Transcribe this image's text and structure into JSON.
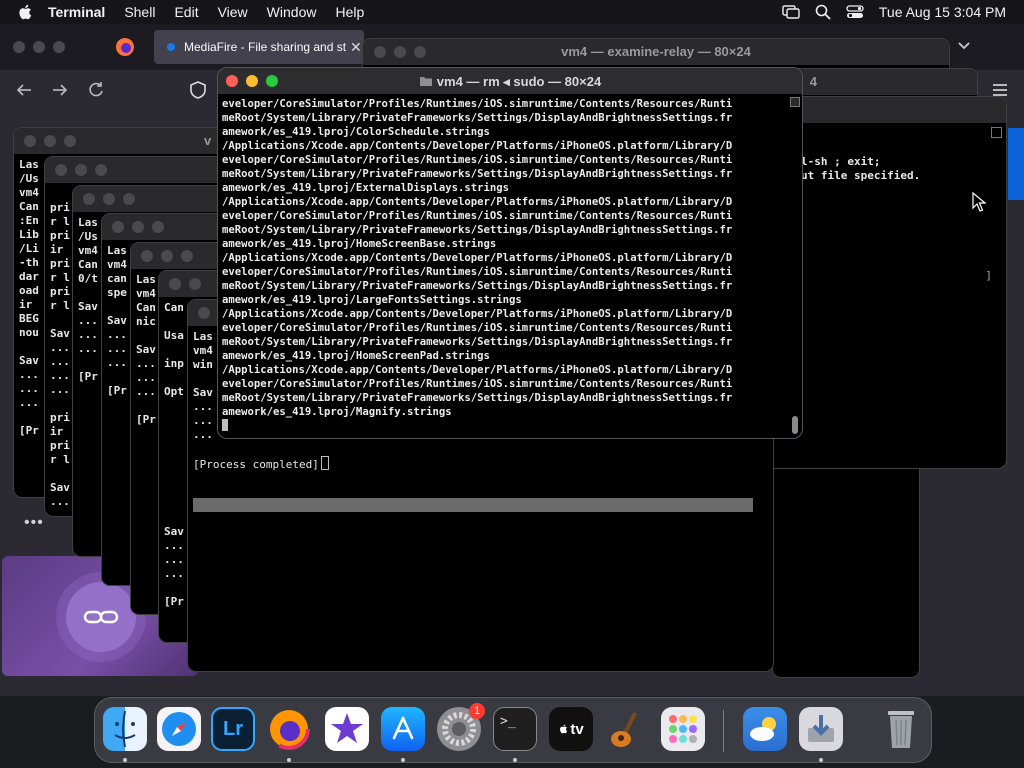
{
  "menubar": {
    "app_name": "Terminal",
    "items": [
      "Shell",
      "Edit",
      "View",
      "Window",
      "Help"
    ],
    "clock": "Tue Aug 15  3:04 PM",
    "icons": [
      "screen-mirroring-icon",
      "search-icon",
      "control-center-icon"
    ]
  },
  "browser": {
    "active_tab_title": "MediaFire - File sharing and stor",
    "tab_close": "✕",
    "page_dots": "•••"
  },
  "windows": {
    "examine_relay_title": "vm4 — examine-relay — 80×24",
    "examine_relay_lines": [
      "l-sh ; exit;",
      "ut file specified."
    ],
    "bg_title_small": "v",
    "bg_title_right": "4",
    "w1_lines": [
      "Las",
      "/Us",
      "vm4",
      "Can",
      ":En",
      "Lib",
      "/Li",
      "-th",
      "dar",
      "oad",
      "ir ",
      "BEG",
      "nou",
      "",
      "Sav",
      "...",
      "...",
      "...",
      "",
      "[Pr"
    ],
    "w2_lines": [
      "",
      "pri",
      "r l",
      "pri",
      "ir ",
      "pri",
      "r l",
      "pri",
      "r l",
      "",
      "Sav",
      "...",
      "...",
      "...",
      "...",
      "",
      "pri",
      "ir ",
      "pri",
      "r l",
      "",
      "Sav",
      "...",
      "...",
      "...",
      "",
      "[Pr"
    ],
    "w3_lines": [
      "Las",
      "/Us",
      "vm4",
      "Can",
      "0/t",
      "",
      "Sav",
      "...",
      "...",
      "...",
      "",
      "[Pr"
    ],
    "w4_lines": [
      "Las",
      "vm4",
      "can",
      "spe",
      "",
      "Sav",
      "...",
      "...",
      "...",
      "",
      "[Pr"
    ],
    "w5_lines": [
      "Las",
      "vm4",
      "Can",
      "nic",
      "",
      "Sav",
      "...",
      "...",
      "...",
      "",
      "[Pr"
    ],
    "w6_lines": [
      "Can",
      "",
      "Usa",
      "",
      "inp",
      "",
      "Opt",
      "",
      "",
      "",
      "",
      "",
      "",
      "",
      "",
      "",
      "Sav",
      "...",
      "...",
      "...",
      "",
      "[Pr"
    ],
    "w7_lines": [
      "Las",
      "vm4",
      "win",
      "",
      "Sav",
      "...",
      "...",
      "..."
    ],
    "process_completed": "[Process completed]"
  },
  "main_terminal": {
    "title": "vm4 — rm ◂ sudo — 80×24",
    "lines": [
      "eveloper/CoreSimulator/Profiles/Runtimes/iOS.simruntime/Contents/Resources/Runti",
      "meRoot/System/Library/PrivateFrameworks/Settings/DisplayAndBrightnessSettings.fr",
      "amework/es_419.lproj/ColorSchedule.strings",
      "/Applications/Xcode.app/Contents/Developer/Platforms/iPhoneOS.platform/Library/D",
      "eveloper/CoreSimulator/Profiles/Runtimes/iOS.simruntime/Contents/Resources/Runti",
      "meRoot/System/Library/PrivateFrameworks/Settings/DisplayAndBrightnessSettings.fr",
      "amework/es_419.lproj/ExternalDisplays.strings",
      "/Applications/Xcode.app/Contents/Developer/Platforms/iPhoneOS.platform/Library/D",
      "eveloper/CoreSimulator/Profiles/Runtimes/iOS.simruntime/Contents/Resources/Runti",
      "meRoot/System/Library/PrivateFrameworks/Settings/DisplayAndBrightnessSettings.fr",
      "amework/es_419.lproj/HomeScreenBase.strings",
      "/Applications/Xcode.app/Contents/Developer/Platforms/iPhoneOS.platform/Library/D",
      "eveloper/CoreSimulator/Profiles/Runtimes/iOS.simruntime/Contents/Resources/Runti",
      "meRoot/System/Library/PrivateFrameworks/Settings/DisplayAndBrightnessSettings.fr",
      "amework/es_419.lproj/LargeFontsSettings.strings",
      "/Applications/Xcode.app/Contents/Developer/Platforms/iPhoneOS.platform/Library/D",
      "eveloper/CoreSimulator/Profiles/Runtimes/iOS.simruntime/Contents/Resources/Runti",
      "meRoot/System/Library/PrivateFrameworks/Settings/DisplayAndBrightnessSettings.fr",
      "amework/es_419.lproj/HomeScreenPad.strings",
      "/Applications/Xcode.app/Contents/Developer/Platforms/iPhoneOS.platform/Library/D",
      "eveloper/CoreSimulator/Profiles/Runtimes/iOS.simruntime/Contents/Resources/Runti",
      "meRoot/System/Library/PrivateFrameworks/Settings/DisplayAndBrightnessSettings.fr",
      "amework/es_419.lproj/Magnify.strings"
    ]
  },
  "dock": {
    "apps": [
      {
        "name": "finder",
        "icon": "finder-icon",
        "running": true
      },
      {
        "name": "safari",
        "icon": "safari-icon",
        "running": false
      },
      {
        "name": "lightroom",
        "icon": "lightroom-icon",
        "label": "Lr",
        "running": false
      },
      {
        "name": "firefox",
        "icon": "firefox-icon",
        "running": true
      },
      {
        "name": "imovie",
        "icon": "imovie-icon",
        "running": false
      },
      {
        "name": "app-store",
        "icon": "app-store-icon",
        "running": true
      },
      {
        "name": "system-settings",
        "icon": "gear-icon",
        "badge": "1",
        "running": false
      },
      {
        "name": "terminal",
        "icon": "terminal-icon",
        "label": ">_",
        "running": true
      },
      {
        "name": "apple-tv",
        "icon": "apple-tv-icon",
        "label": "tv",
        "running": false
      },
      {
        "name": "garageband",
        "icon": "guitar-icon",
        "running": false
      },
      {
        "name": "launchpad",
        "icon": "launchpad-icon",
        "running": false
      },
      {
        "name": "weather",
        "icon": "weather-icon",
        "running": false
      },
      {
        "name": "downloads",
        "icon": "downloads-icon",
        "running": true
      },
      {
        "name": "trash",
        "icon": "trash-icon",
        "running": false
      }
    ]
  },
  "colors": {
    "terminal_bg": "#000000",
    "titlebar": "#2d2d30",
    "close": "#ff5f57",
    "minimize": "#febc2e",
    "zoom": "#28c840",
    "badge": "#ff3b30"
  }
}
